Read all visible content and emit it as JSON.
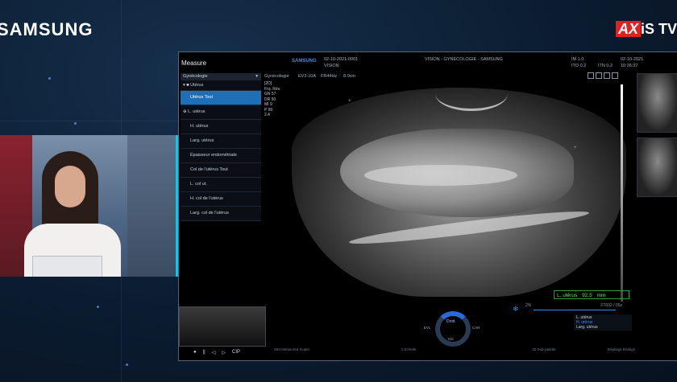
{
  "brand": {
    "samsung": "SAMSUNG",
    "axis_part1": "AX",
    "axis_part2": "iS TV"
  },
  "ultrasound": {
    "measure_title": "Measure",
    "samsung_logo": "SAMSUNG",
    "patient_id": "02-10-2021-0001",
    "patient_label": "VISION",
    "exam_header": "VISION - GYNECOLOGIE - SAMSUNG",
    "date": "02-10-2021",
    "time": "10:36:37",
    "im": "IM 1.0",
    "ito": "ITO 0.2",
    "itn": "ITN 0.2",
    "preset": "Gynécologie",
    "probe": "EV2-10A",
    "freq": "FR44Hz",
    "depth": "8.0cm",
    "params": [
      "[2D]",
      "Frq. Rés.",
      "GN 57",
      "DR 50",
      "MI 9",
      "P 99",
      "2.4"
    ]
  },
  "menu": {
    "dropdown": "Gynécologie",
    "group": "Utérus",
    "items": [
      "Utérus Tout",
      "L. utérus",
      "H. utérus",
      "Larg. utérus",
      "Épaisseur endométriale",
      "Col de l'utérus Tout",
      "L. col ut.",
      "H. col de l'utérus",
      "Larg. col de l'utérus"
    ]
  },
  "measurement": {
    "label": "L. utérus",
    "value": "92.5",
    "unit": "mm"
  },
  "tgc": {
    "left": "2%",
    "right": "FT032 / 05x"
  },
  "legend": [
    "L. utérus",
    "H. utérus",
    "Larg. utérus"
  ],
  "dial": {
    "center": "Droit",
    "left": "EVL",
    "right": "CAR",
    "bottom": "Clé"
  },
  "softkeys": [
    "SEU Measured Scaler",
    "1 Echelle",
    "20 Sub-palette",
    "Dépliage Réalign"
  ],
  "mini_controls": [
    "●",
    "||",
    "◁",
    "▷",
    "CIP"
  ]
}
